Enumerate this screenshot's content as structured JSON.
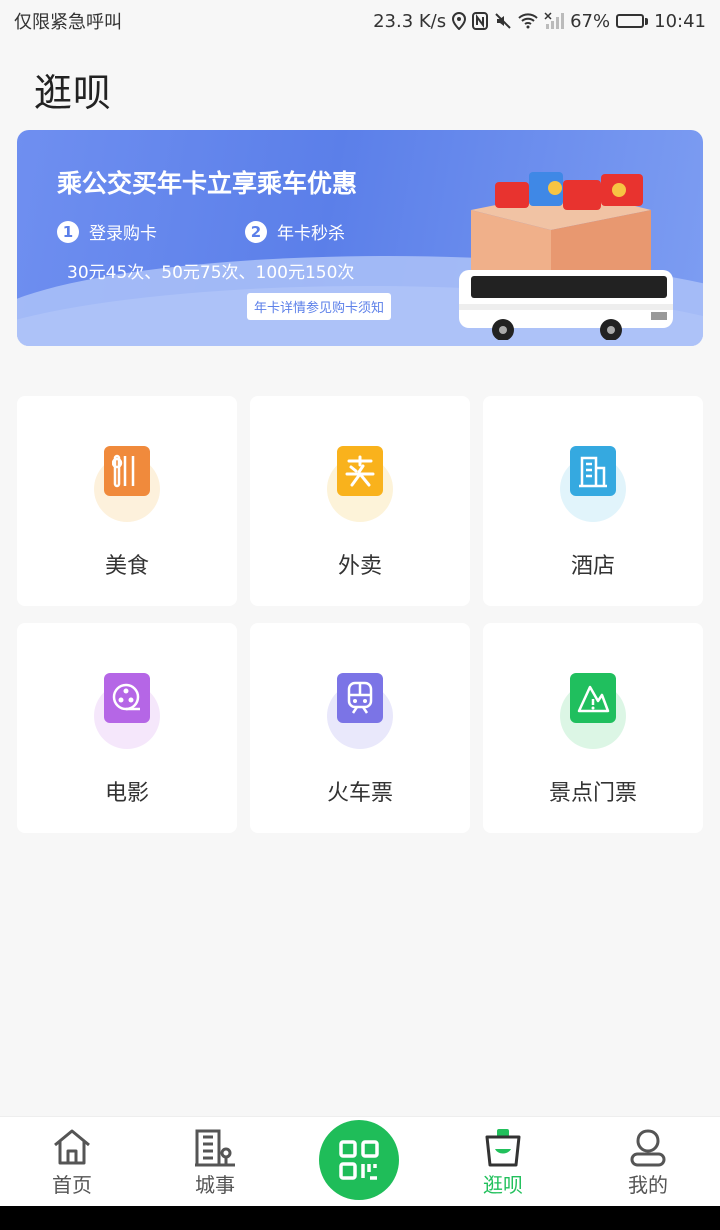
{
  "status_bar": {
    "carrier_text": "仅限紧急呼叫",
    "speed": "23.3 K/s",
    "battery": "67%",
    "battery_level": 0.67,
    "time": "10:41"
  },
  "page": {
    "title": "逛呗"
  },
  "banner": {
    "title": "乘公交买年卡立享乘车优惠",
    "step1_num": "1",
    "step1_label": "登录购卡",
    "step2_num": "2",
    "step2_label": "年卡秒杀",
    "prices": "30元45次、50元75次、100元150次",
    "link": "年卡详情参见购卡须知",
    "colors": {
      "bg": "#5b7fe9",
      "wave": "#d5e0fb"
    }
  },
  "categories": [
    {
      "label": "美食",
      "icon": "fork-knife-icon",
      "color": "#f08a3c",
      "halo": "#fdf1dc"
    },
    {
      "label": "外卖",
      "icon": "takeout-icon",
      "color": "#f9b21c",
      "halo": "#fdf3d9"
    },
    {
      "label": "酒店",
      "icon": "hotel-icon",
      "color": "#35a9e0",
      "halo": "#e1f4fb"
    },
    {
      "label": "电影",
      "icon": "film-reel-icon",
      "color": "#b566e6",
      "halo": "#f5e7fb"
    },
    {
      "label": "火车票",
      "icon": "train-icon",
      "color": "#7b74e6",
      "halo": "#e9e8fb"
    },
    {
      "label": "景点门票",
      "icon": "scenic-ticket-icon",
      "color": "#20bf5e",
      "halo": "#dcf6e5"
    }
  ],
  "nav": {
    "home": "首页",
    "city": "城事",
    "browse": "逛呗",
    "mine": "我的",
    "active_color": "#22c05c",
    "scan_color": "#1fbd59"
  }
}
